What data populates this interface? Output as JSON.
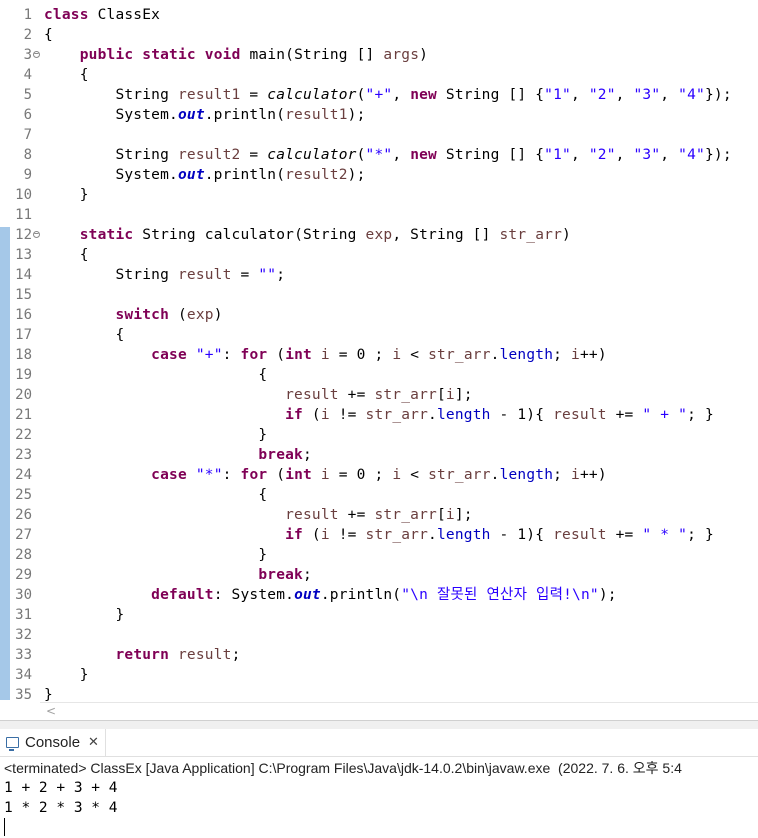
{
  "editor": {
    "lines": [
      [
        {
          "t": "class",
          "c": "kw"
        },
        {
          "t": " ClassEx",
          "c": ""
        }
      ],
      [
        {
          "t": "{",
          "c": ""
        }
      ],
      [
        {
          "t": "    ",
          "c": ""
        },
        {
          "t": "public",
          "c": "kw"
        },
        {
          "t": " ",
          "c": ""
        },
        {
          "t": "static",
          "c": "kw"
        },
        {
          "t": " ",
          "c": ""
        },
        {
          "t": "void",
          "c": "kw"
        },
        {
          "t": " main(String [] ",
          "c": ""
        },
        {
          "t": "args",
          "c": "var"
        },
        {
          "t": ")",
          "c": ""
        }
      ],
      [
        {
          "t": "    {",
          "c": ""
        }
      ],
      [
        {
          "t": "        String ",
          "c": ""
        },
        {
          "t": "result1",
          "c": "var"
        },
        {
          "t": " = ",
          "c": ""
        },
        {
          "t": "calculator",
          "c": "sm"
        },
        {
          "t": "(",
          "c": ""
        },
        {
          "t": "\"+\"",
          "c": "str"
        },
        {
          "t": ", ",
          "c": ""
        },
        {
          "t": "new",
          "c": "kw"
        },
        {
          "t": " String [] {",
          "c": ""
        },
        {
          "t": "\"1\"",
          "c": "str"
        },
        {
          "t": ", ",
          "c": ""
        },
        {
          "t": "\"2\"",
          "c": "str"
        },
        {
          "t": ", ",
          "c": ""
        },
        {
          "t": "\"3\"",
          "c": "str"
        },
        {
          "t": ", ",
          "c": ""
        },
        {
          "t": "\"4\"",
          "c": "str"
        },
        {
          "t": "});",
          "c": ""
        }
      ],
      [
        {
          "t": "        System.",
          "c": ""
        },
        {
          "t": "out",
          "c": "sfld"
        },
        {
          "t": ".println(",
          "c": ""
        },
        {
          "t": "result1",
          "c": "var"
        },
        {
          "t": ");",
          "c": ""
        }
      ],
      [
        {
          "t": "",
          "c": ""
        }
      ],
      [
        {
          "t": "        String ",
          "c": ""
        },
        {
          "t": "result2",
          "c": "var"
        },
        {
          "t": " = ",
          "c": ""
        },
        {
          "t": "calculator",
          "c": "sm"
        },
        {
          "t": "(",
          "c": ""
        },
        {
          "t": "\"*\"",
          "c": "str"
        },
        {
          "t": ", ",
          "c": ""
        },
        {
          "t": "new",
          "c": "kw"
        },
        {
          "t": " String [] {",
          "c": ""
        },
        {
          "t": "\"1\"",
          "c": "str"
        },
        {
          "t": ", ",
          "c": ""
        },
        {
          "t": "\"2\"",
          "c": "str"
        },
        {
          "t": ", ",
          "c": ""
        },
        {
          "t": "\"3\"",
          "c": "str"
        },
        {
          "t": ", ",
          "c": ""
        },
        {
          "t": "\"4\"",
          "c": "str"
        },
        {
          "t": "});",
          "c": ""
        }
      ],
      [
        {
          "t": "        System.",
          "c": ""
        },
        {
          "t": "out",
          "c": "sfld"
        },
        {
          "t": ".println(",
          "c": ""
        },
        {
          "t": "result2",
          "c": "var"
        },
        {
          "t": ");",
          "c": ""
        }
      ],
      [
        {
          "t": "    }",
          "c": ""
        }
      ],
      [
        {
          "t": "",
          "c": ""
        }
      ],
      [
        {
          "t": "    ",
          "c": ""
        },
        {
          "t": "static",
          "c": "kw"
        },
        {
          "t": " String calculator(String ",
          "c": ""
        },
        {
          "t": "exp",
          "c": "var"
        },
        {
          "t": ", String [] ",
          "c": ""
        },
        {
          "t": "str_arr",
          "c": "var"
        },
        {
          "t": ")",
          "c": ""
        }
      ],
      [
        {
          "t": "    {",
          "c": ""
        }
      ],
      [
        {
          "t": "        String ",
          "c": ""
        },
        {
          "t": "result",
          "c": "var"
        },
        {
          "t": " = ",
          "c": ""
        },
        {
          "t": "\"\"",
          "c": "str"
        },
        {
          "t": ";",
          "c": ""
        }
      ],
      [
        {
          "t": "",
          "c": ""
        }
      ],
      [
        {
          "t": "        ",
          "c": ""
        },
        {
          "t": "switch",
          "c": "kw"
        },
        {
          "t": " (",
          "c": ""
        },
        {
          "t": "exp",
          "c": "var"
        },
        {
          "t": ")",
          "c": ""
        }
      ],
      [
        {
          "t": "        {",
          "c": ""
        }
      ],
      [
        {
          "t": "            ",
          "c": ""
        },
        {
          "t": "case",
          "c": "kw"
        },
        {
          "t": " ",
          "c": ""
        },
        {
          "t": "\"+\"",
          "c": "str"
        },
        {
          "t": ": ",
          "c": ""
        },
        {
          "t": "for",
          "c": "kw"
        },
        {
          "t": " (",
          "c": ""
        },
        {
          "t": "int",
          "c": "kw"
        },
        {
          "t": " ",
          "c": ""
        },
        {
          "t": "i",
          "c": "var"
        },
        {
          "t": " = 0 ; ",
          "c": ""
        },
        {
          "t": "i",
          "c": "var"
        },
        {
          "t": " < ",
          "c": ""
        },
        {
          "t": "str_arr",
          "c": "var"
        },
        {
          "t": ".",
          "c": ""
        },
        {
          "t": "length",
          "c": "fld"
        },
        {
          "t": "; ",
          "c": ""
        },
        {
          "t": "i",
          "c": "var"
        },
        {
          "t": "++)",
          "c": ""
        }
      ],
      [
        {
          "t": "                        {",
          "c": ""
        }
      ],
      [
        {
          "t": "                           ",
          "c": ""
        },
        {
          "t": "result",
          "c": "var"
        },
        {
          "t": " += ",
          "c": ""
        },
        {
          "t": "str_arr",
          "c": "var"
        },
        {
          "t": "[",
          "c": ""
        },
        {
          "t": "i",
          "c": "var"
        },
        {
          "t": "];",
          "c": ""
        }
      ],
      [
        {
          "t": "                           ",
          "c": ""
        },
        {
          "t": "if",
          "c": "kw"
        },
        {
          "t": " (",
          "c": ""
        },
        {
          "t": "i",
          "c": "var"
        },
        {
          "t": " != ",
          "c": ""
        },
        {
          "t": "str_arr",
          "c": "var"
        },
        {
          "t": ".",
          "c": ""
        },
        {
          "t": "length",
          "c": "fld"
        },
        {
          "t": " - 1){ ",
          "c": ""
        },
        {
          "t": "result",
          "c": "var"
        },
        {
          "t": " += ",
          "c": ""
        },
        {
          "t": "\" + \"",
          "c": "str"
        },
        {
          "t": "; }",
          "c": ""
        }
      ],
      [
        {
          "t": "                        }",
          "c": ""
        }
      ],
      [
        {
          "t": "                        ",
          "c": ""
        },
        {
          "t": "break",
          "c": "kw"
        },
        {
          "t": ";",
          "c": ""
        }
      ],
      [
        {
          "t": "            ",
          "c": ""
        },
        {
          "t": "case",
          "c": "kw"
        },
        {
          "t": " ",
          "c": ""
        },
        {
          "t": "\"*\"",
          "c": "str"
        },
        {
          "t": ": ",
          "c": ""
        },
        {
          "t": "for",
          "c": "kw"
        },
        {
          "t": " (",
          "c": ""
        },
        {
          "t": "int",
          "c": "kw"
        },
        {
          "t": " ",
          "c": ""
        },
        {
          "t": "i",
          "c": "var"
        },
        {
          "t": " = 0 ; ",
          "c": ""
        },
        {
          "t": "i",
          "c": "var"
        },
        {
          "t": " < ",
          "c": ""
        },
        {
          "t": "str_arr",
          "c": "var"
        },
        {
          "t": ".",
          "c": ""
        },
        {
          "t": "length",
          "c": "fld"
        },
        {
          "t": "; ",
          "c": ""
        },
        {
          "t": "i",
          "c": "var"
        },
        {
          "t": "++)",
          "c": ""
        }
      ],
      [
        {
          "t": "                        {",
          "c": ""
        }
      ],
      [
        {
          "t": "                           ",
          "c": ""
        },
        {
          "t": "result",
          "c": "var"
        },
        {
          "t": " += ",
          "c": ""
        },
        {
          "t": "str_arr",
          "c": "var"
        },
        {
          "t": "[",
          "c": ""
        },
        {
          "t": "i",
          "c": "var"
        },
        {
          "t": "];",
          "c": ""
        }
      ],
      [
        {
          "t": "                           ",
          "c": ""
        },
        {
          "t": "if",
          "c": "kw"
        },
        {
          "t": " (",
          "c": ""
        },
        {
          "t": "i",
          "c": "var"
        },
        {
          "t": " != ",
          "c": ""
        },
        {
          "t": "str_arr",
          "c": "var"
        },
        {
          "t": ".",
          "c": ""
        },
        {
          "t": "length",
          "c": "fld"
        },
        {
          "t": " - 1){ ",
          "c": ""
        },
        {
          "t": "result",
          "c": "var"
        },
        {
          "t": " += ",
          "c": ""
        },
        {
          "t": "\" * \"",
          "c": "str"
        },
        {
          "t": "; }",
          "c": ""
        }
      ],
      [
        {
          "t": "                        }",
          "c": ""
        }
      ],
      [
        {
          "t": "                        ",
          "c": ""
        },
        {
          "t": "break",
          "c": "kw"
        },
        {
          "t": ";",
          "c": ""
        }
      ],
      [
        {
          "t": "            ",
          "c": ""
        },
        {
          "t": "default",
          "c": "kw"
        },
        {
          "t": ": System.",
          "c": ""
        },
        {
          "t": "out",
          "c": "sfld"
        },
        {
          "t": ".println(",
          "c": ""
        },
        {
          "t": "\"\\n 잘못된 연산자 입력!\\n\"",
          "c": "str"
        },
        {
          "t": ");",
          "c": ""
        }
      ],
      [
        {
          "t": "        }",
          "c": ""
        }
      ],
      [
        {
          "t": "",
          "c": ""
        }
      ],
      [
        {
          "t": "        ",
          "c": ""
        },
        {
          "t": "return",
          "c": "kw"
        },
        {
          "t": " ",
          "c": ""
        },
        {
          "t": "result",
          "c": "var"
        },
        {
          "t": ";",
          "c": ""
        }
      ],
      [
        {
          "t": "    }",
          "c": ""
        }
      ],
      [
        {
          "t": "}",
          "c": ""
        }
      ]
    ],
    "fold_lines": [
      3,
      12
    ]
  },
  "console": {
    "tab_label": "Console",
    "tab_icon": "console-icon",
    "close_glyph": "✕",
    "terminated_text": "<terminated> ClassEx [Java Application] C:\\Program Files\\Java\\jdk-14.0.2\\bin\\javaw.exe  (2022. 7. 6. 오후 5:4",
    "output": [
      "1 + 2 + 3 + 4",
      "1 * 2 * 3 * 4"
    ]
  },
  "scroll_left_glyph": "<"
}
